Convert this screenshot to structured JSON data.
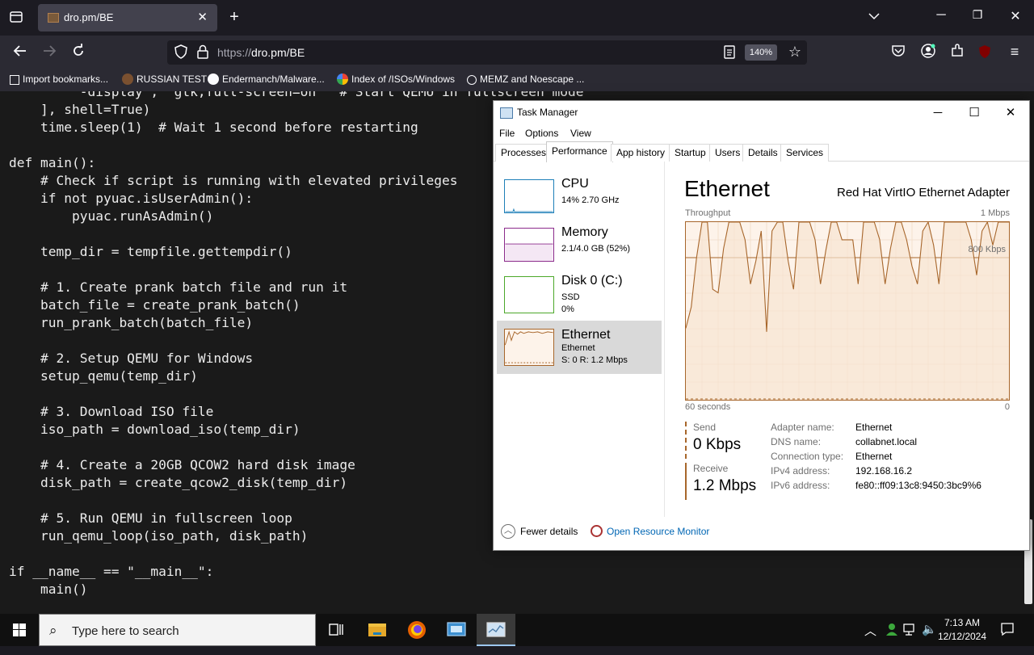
{
  "browser": {
    "tab_title": "dro.pm/BE",
    "tab_close": "✕",
    "new_tab": "+",
    "url_proto": "https://",
    "url_rest": "dro.pm/BE",
    "zoom": "140%",
    "bookmarks": [
      {
        "label": "Import bookmarks...",
        "icon": "import-icon",
        "color": "#fbfbfe"
      },
      {
        "label": "RUSSIAN TEST",
        "icon": "site-favicon",
        "color": "#7a5030"
      },
      {
        "label": "Endermanch/Malware...",
        "icon": "github-icon",
        "color": "#fbfbfe"
      },
      {
        "label": "Index of /ISOs/Windows",
        "icon": "google-icon",
        "color": "#fbfbfe"
      },
      {
        "label": "MEMZ and Noescape ...",
        "icon": "globe-icon",
        "color": "#fbfbfe"
      }
    ]
  },
  "code_lines": [
    "        '-display', 'gtk,full-screen=on'  # Start QEMU in fullscreen mode",
    "    ], shell=True)",
    "    time.sleep(1)  # Wait 1 second before restarting",
    "",
    "def main():",
    "    # Check if script is running with elevated privileges",
    "    if not pyuac.isUserAdmin():",
    "        pyuac.runAsAdmin()",
    "",
    "    temp_dir = tempfile.gettempdir()",
    "",
    "    # 1. Create prank batch file and run it",
    "    batch_file = create_prank_batch()",
    "    run_prank_batch(batch_file)",
    "",
    "    # 2. Setup QEMU for Windows",
    "    setup_qemu(temp_dir)",
    "",
    "    # 3. Download ISO file",
    "    iso_path = download_iso(temp_dir)",
    "",
    "    # 4. Create a 20GB QCOW2 hard disk image",
    "    disk_path = create_qcow2_disk(temp_dir)",
    "",
    "    # 5. Run QEMU in fullscreen loop",
    "    run_qemu_loop(iso_path, disk_path)",
    "",
    "if __name__ == \"__main__\":",
    "    main()"
  ],
  "task_manager": {
    "title": "Task Manager",
    "menu": [
      "File",
      "Options",
      "View"
    ],
    "tabs": [
      "Processes",
      "Performance",
      "App history",
      "Startup",
      "Users",
      "Details",
      "Services"
    ],
    "active_tab": "Performance",
    "side": [
      {
        "name": "CPU",
        "sub1": "14% 2.70 GHz",
        "sub2": "",
        "sub3": "",
        "color": "#1e7fb8"
      },
      {
        "name": "Memory",
        "sub1": "2.1/4.0 GB (52%)",
        "sub2": "",
        "sub3": "",
        "color": "#8b2b8b"
      },
      {
        "name": "Disk 0 (C:)",
        "sub1": "SSD",
        "sub2": "0%",
        "sub3": "",
        "color": "#4ca82a"
      },
      {
        "name": "Ethernet",
        "sub1": "Ethernet",
        "sub2": "S: 0 R: 1.2 Mbps",
        "sub3": "",
        "color": "#a7662b"
      }
    ],
    "detail": {
      "heading": "Ethernet",
      "adapter": "Red Hat VirtIO Ethernet Adapter",
      "graph_label": "Throughput",
      "graph_max": "1 Mbps",
      "graph_mid": "800 Kbps",
      "graph_x_left": "60 seconds",
      "graph_x_right": "0",
      "send_label": "Send",
      "send_value": "0 Kbps",
      "receive_label": "Receive",
      "receive_value": "1.2 Mbps",
      "props": [
        {
          "k": "Adapter name:",
          "v": "Ethernet"
        },
        {
          "k": "DNS name:",
          "v": "collabnet.local"
        },
        {
          "k": "Connection type:",
          "v": "Ethernet"
        },
        {
          "k": "IPv4 address:",
          "v": "192.168.16.2"
        },
        {
          "k": "IPv6 address:",
          "v": "fe80::ff09:13c8:9450:3bc9%6"
        }
      ]
    },
    "fewer_details": "Fewer details",
    "resource_monitor": "Open Resource Monitor"
  },
  "chart_data": {
    "type": "line",
    "ylabel": "Throughput",
    "ylim": [
      0,
      1000
    ],
    "ylim_unit_label": "1 Mbps",
    "reference_line_label": "800 Kbps",
    "xlabel_left": "60 seconds",
    "xlabel_right": "0",
    "series": [
      {
        "name": "Receive",
        "color": "#a7662b",
        "values": [
          400,
          520,
          800,
          1000,
          1000,
          620,
          600,
          850,
          1000,
          1000,
          1000,
          900,
          650,
          780,
          950,
          380,
          950,
          1000,
          1000,
          780,
          620,
          1000,
          1000,
          1000,
          900,
          650,
          840,
          1000,
          1000,
          900,
          900,
          900,
          650,
          1000,
          1000,
          1000,
          900,
          650,
          850,
          1000,
          1000,
          900,
          750,
          650,
          950,
          1000,
          870,
          650,
          1000,
          1000,
          1000,
          1000,
          1000,
          900,
          700,
          950,
          1000,
          870,
          1000,
          1000,
          1000
        ]
      },
      {
        "name": "Send",
        "color": "#a7662b",
        "values": [
          0,
          0,
          0,
          0,
          0,
          0,
          0,
          0,
          0,
          0,
          0,
          0,
          0,
          0,
          0,
          0,
          0,
          0,
          0,
          0,
          0,
          0,
          0,
          0,
          0,
          0,
          0,
          0,
          0,
          0,
          0,
          0,
          0,
          0,
          0,
          0,
          0,
          0,
          0,
          0,
          0,
          0,
          0,
          0,
          0,
          0,
          0,
          0,
          0,
          0,
          0,
          0,
          0,
          0,
          0,
          0,
          0,
          0,
          0,
          0,
          0
        ]
      }
    ]
  },
  "taskbar": {
    "search_placeholder": "Type here to search",
    "time": "7:13 AM",
    "date": "12/12/2024"
  }
}
